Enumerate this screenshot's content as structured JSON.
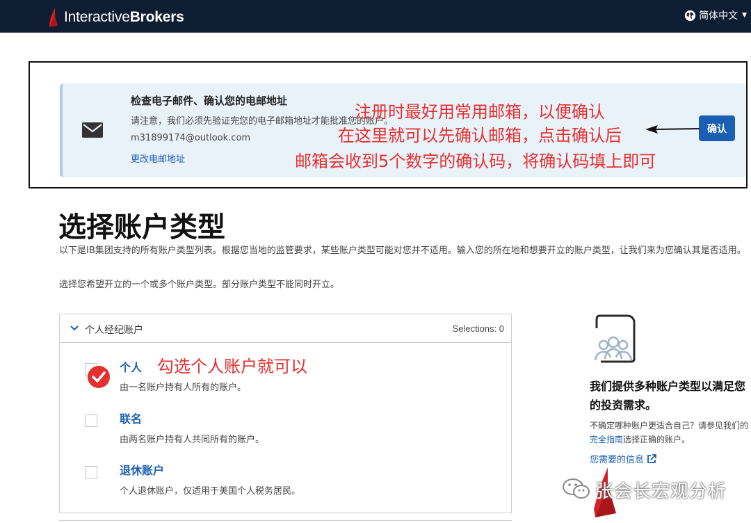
{
  "header": {
    "brand_prefix": "Interactive",
    "brand_suffix": "Brokers",
    "language": "简体中文"
  },
  "email_notice": {
    "title": "检查电子邮件、确认您的电邮地址",
    "note": "请注意，我们必须先验证完您的电子邮箱地址才能批准您的账户。",
    "email": "m31899174@outlook.com",
    "change_link": "更改电邮地址",
    "confirm_button": "确认"
  },
  "annotations": {
    "line1": "注册时最好用常用邮箱，以便确认",
    "line2": "在这里就可以先确认邮箱，点击确认后",
    "line3": "邮箱会收到5个数字的确认码，将确认码填上即可",
    "select_note": "勾选个人账户就可以"
  },
  "section": {
    "title": "选择账户类型",
    "description": "以下是IB集团支持的所有账户类型列表。根据您当地的监管要求，某些账户类型可能对您并不适用。输入您的所在地和想要开立的账户类型，让我们来为您确认其是否适用。",
    "instruction": "选择您希望开立的一个或多个账户类型。部分账户类型不能同时开立。"
  },
  "account_group": {
    "label": "个人经纪账户",
    "selections": "Selections: 0",
    "options": [
      {
        "label": "个人",
        "desc": "由一名账户持有人所有的账户。"
      },
      {
        "label": "联名",
        "desc": "由两名账户持有人共同所有的账户。"
      },
      {
        "label": "退休账户",
        "desc": "个人退休账户，仅适用于美国个人税务居民。"
      }
    ]
  },
  "info": {
    "title": "我们提供多种账户类型以满足您的投资需求。",
    "text_before": "不确定哪种账户更适合自己？请参见我们的",
    "guide_link": "完全指南",
    "text_after": "选择正确的账户。",
    "info_link": "您需要的信息"
  },
  "watermark": {
    "text": "张会长宏观分析"
  },
  "colors": {
    "topbar": "#0f1d33",
    "brand_red": "#d81f26",
    "accent_blue": "#1a5fb4",
    "annotation_red": "#e53030",
    "panel_bg": "#eaf2f9"
  }
}
